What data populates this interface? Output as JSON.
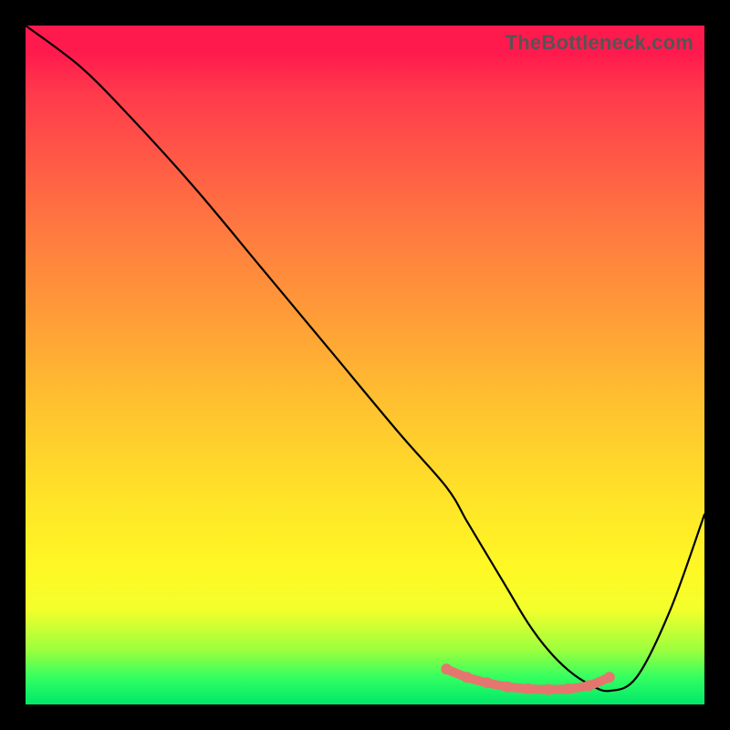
{
  "watermark": "TheBottleneck.com",
  "chart_data": {
    "type": "line",
    "title": "",
    "xlabel": "",
    "ylabel": "",
    "xlim": [
      0,
      100
    ],
    "ylim": [
      0,
      100
    ],
    "grid": false,
    "legend": false,
    "series": [
      {
        "name": "bottleneck-curve",
        "x": [
          0,
          8,
          15,
          25,
          35,
          45,
          55,
          62,
          65,
          68,
          71,
          74,
          77,
          80,
          83,
          86,
          90,
          95,
          100
        ],
        "values": [
          100,
          94,
          87,
          76,
          64,
          52,
          40,
          32,
          27,
          22,
          17,
          12,
          8,
          5,
          3,
          2,
          4,
          14,
          28
        ]
      }
    ],
    "highlight": {
      "name": "minimum-band",
      "x": [
        62,
        65,
        68,
        71,
        74,
        77,
        80,
        83,
        86
      ],
      "values": [
        5.2,
        4.0,
        3.2,
        2.6,
        2.3,
        2.2,
        2.3,
        2.8,
        4.0
      ]
    },
    "background_gradient": {
      "top": "#ff1a4d",
      "upper_mid": "#ff7940",
      "mid": "#ffe428",
      "lower_mid": "#9cff3e",
      "bottom": "#00e86a"
    }
  }
}
